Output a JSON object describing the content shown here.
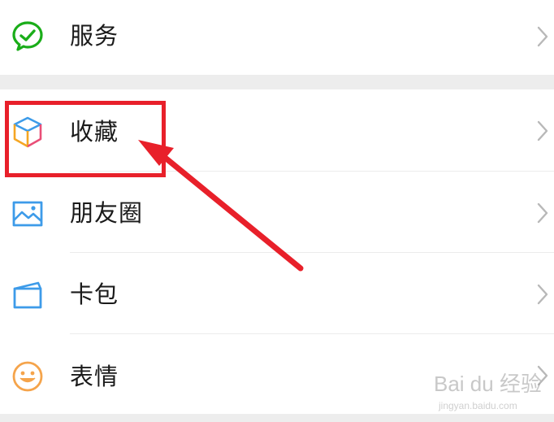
{
  "menu": {
    "items": [
      {
        "label": "服务",
        "icon": "service-icon"
      },
      {
        "label": "收藏",
        "icon": "favorites-icon"
      },
      {
        "label": "朋友圈",
        "icon": "moments-icon"
      },
      {
        "label": "卡包",
        "icon": "card-wallet-icon"
      },
      {
        "label": "表情",
        "icon": "stickers-icon"
      }
    ]
  },
  "annotation": {
    "highlight_color": "#e8202a"
  },
  "watermark": {
    "main": "Bai du 经验",
    "sub": "jingyan.baidu.com"
  },
  "colors": {
    "service_green": "#1aad19",
    "icon_blue": "#3d9be9",
    "sticker_orange": "#f5a44b",
    "separator": "#ededed"
  }
}
